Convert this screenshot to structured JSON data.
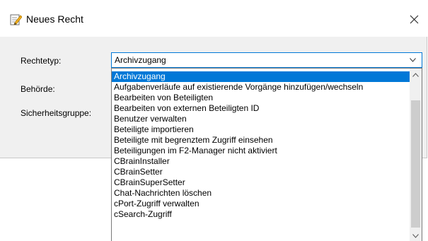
{
  "dialog": {
    "title": "Neues Recht",
    "icon": "edit-document-icon",
    "close_icon": "close-icon"
  },
  "form": {
    "rechtetyp_label": "Rechtetyp:",
    "behoerde_label": "Behörde:",
    "sicherheitsgruppe_label": "Sicherheitsgruppe:",
    "rechtetyp_value": "Archivzugang"
  },
  "dropdown": {
    "items": [
      "Archivzugang",
      "Aufgabenverläufe auf existierende Vorgänge hinzufügen/wechseln",
      "Bearbeiten von Beteiligten",
      "Bearbeiten von externen Beteiligten ID",
      "Benutzer verwalten",
      "Beteiligte importieren",
      "Beteiligte mit begrenztem Zugriff einsehen",
      "Beteiligungen im F2-Manager nicht aktiviert",
      "CBrainInstaller",
      "CBrainSetter",
      "CBrainSuperSetter",
      "Chat-Nachrichten löschen",
      "cPort-Zugriff verwalten",
      "cSearch-Zugriff"
    ],
    "selected_index": 0
  },
  "colors": {
    "accent": "#0078d7",
    "dialog_bg": "#f0f0f0",
    "scroll_thumb": "#cdcdcd"
  }
}
